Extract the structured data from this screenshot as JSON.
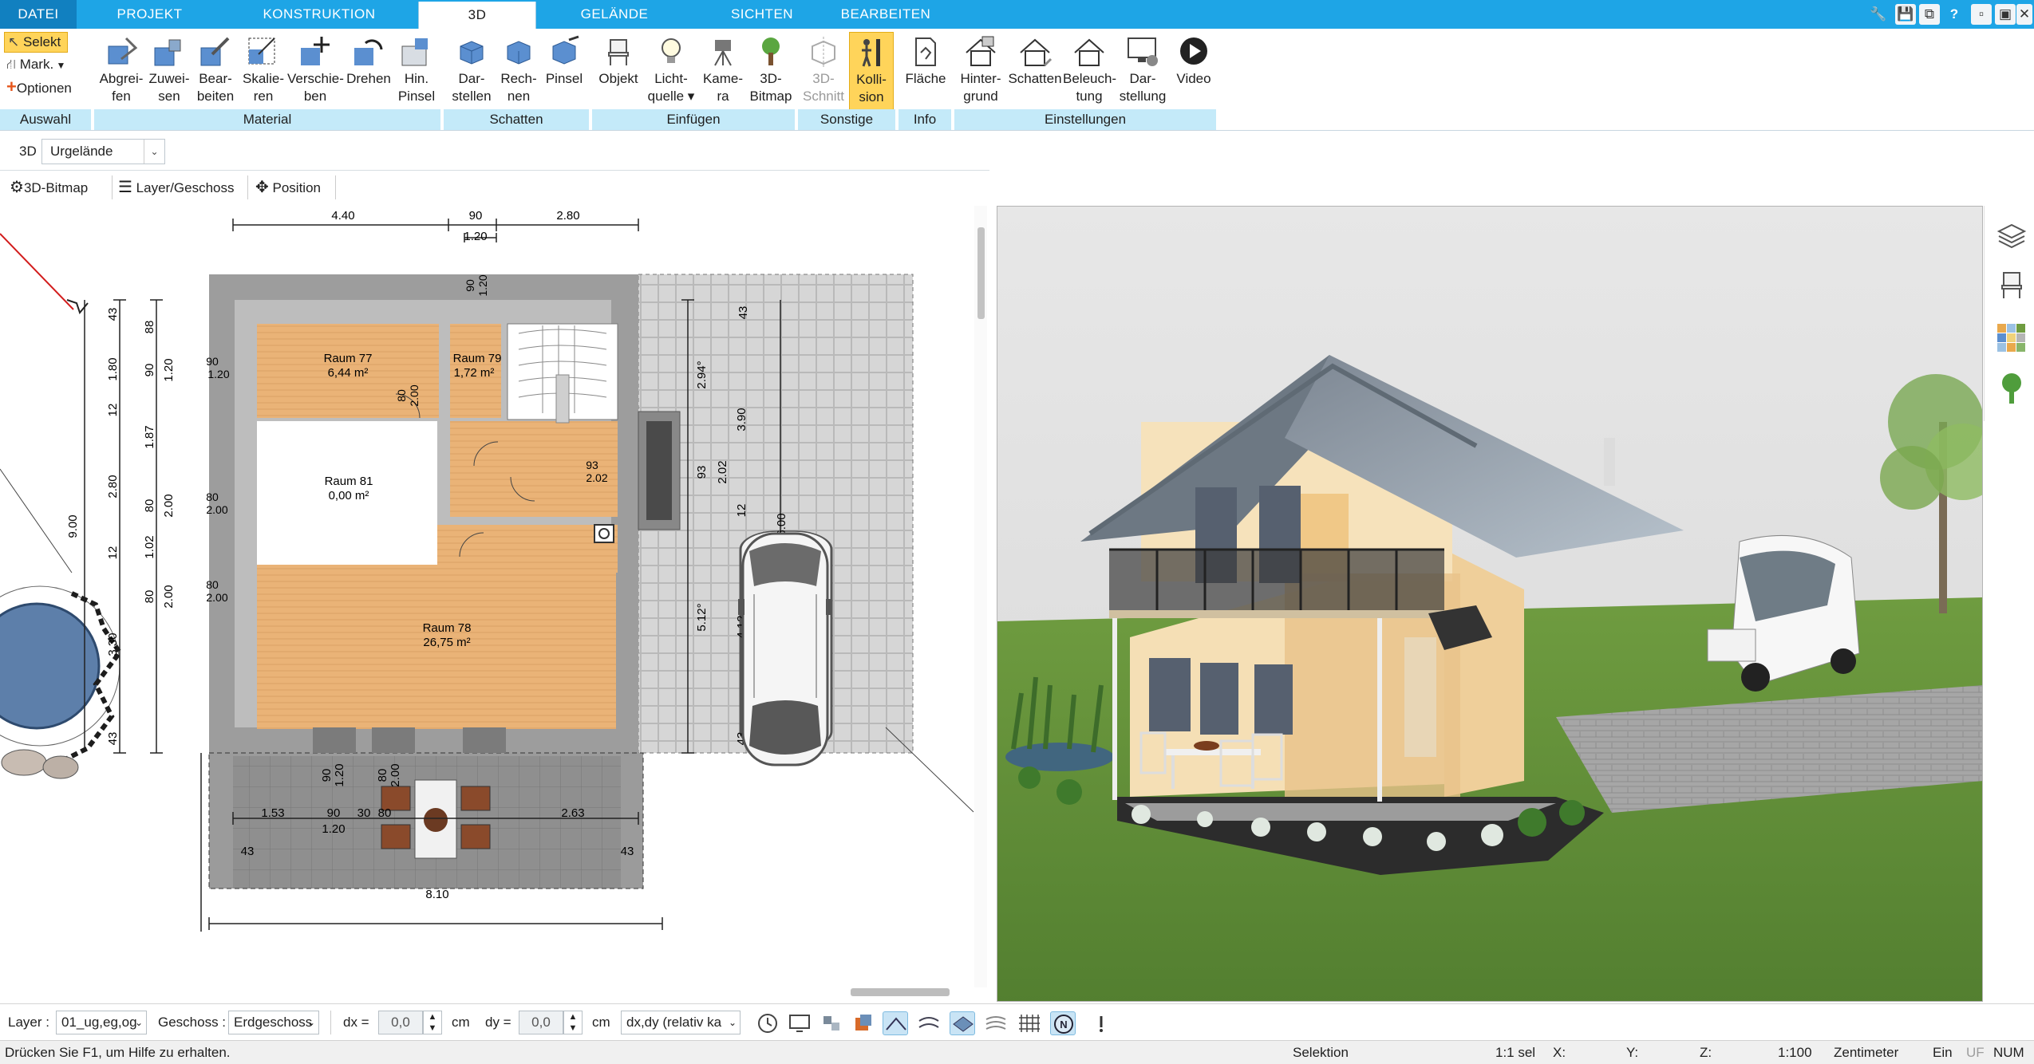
{
  "tabs": [
    {
      "label": "DATEI"
    },
    {
      "label": "PROJEKT"
    },
    {
      "label": "KONSTRUKTION"
    },
    {
      "label": "3D"
    },
    {
      "label": "GELÄNDE"
    },
    {
      "label": "SICHTEN"
    },
    {
      "label": "BEARBEITEN"
    }
  ],
  "window_buttons": {
    "tools": "🔧",
    "save": "💾",
    "copy": "⧉",
    "help": "?",
    "minimize": "▫",
    "restore": "▣",
    "close": "✕"
  },
  "ribbon": {
    "auswahl": {
      "select_label": "Selekt",
      "mark_label": "Mark.",
      "options_label": "Optionen",
      "group": "Auswahl"
    },
    "material": {
      "group": "Material",
      "buttons": [
        {
          "label": "Abgrei-\nfen"
        },
        {
          "label": "Zuwei-\nsen"
        },
        {
          "label": "Bear-\nbeiten"
        },
        {
          "label": "Skalie-\nren"
        },
        {
          "label": "Verschie-\nben"
        },
        {
          "label": "Drehen"
        },
        {
          "label": "Hin.\nPinsel"
        }
      ]
    },
    "schatten": {
      "group": "Schatten",
      "buttons": [
        {
          "label": "Dar-\nstellen"
        },
        {
          "label": "Rech-\nnen"
        },
        {
          "label": "Pinsel"
        }
      ]
    },
    "einfuegen": {
      "group": "Einfügen",
      "buttons": [
        {
          "label": "Objekt"
        },
        {
          "label": "Licht-\nquelle ▾"
        },
        {
          "label": "Kame-\nra"
        },
        {
          "label": "3D-\nBitmap"
        }
      ]
    },
    "sonstige": {
      "group": "Sonstige",
      "buttons": [
        {
          "label": "3D-\nSchnitt"
        },
        {
          "label": "Kolli-\nsion"
        }
      ]
    },
    "info": {
      "group": "Info",
      "buttons": [
        {
          "label": "Fläche"
        }
      ]
    },
    "einstellungen": {
      "group": "Einstellungen",
      "buttons": [
        {
          "label": "Hinter-\ngrund"
        },
        {
          "label": "Schatten"
        },
        {
          "label": "Beleuch-\ntung"
        },
        {
          "label": "Dar-\nstellung"
        },
        {
          "label": "Video"
        }
      ]
    }
  },
  "subbar": {
    "mode": "3D",
    "terrain": "Urgelände",
    "bitmap_btn": "3D-Bitmap",
    "layer_btn": "Layer/Geschoss",
    "position_btn": "Position"
  },
  "plan": {
    "rooms": [
      {
        "name": "Raum 77",
        "area": "6,44 m²"
      },
      {
        "name": "Raum 79",
        "area": "1,72 m²"
      },
      {
        "name": "Raum 81",
        "area": "0,00 m²"
      },
      {
        "name": "Raum 78",
        "area": "26,75 m²"
      }
    ],
    "dims_top": [
      "4.40",
      "90",
      "1.20",
      "2.80"
    ],
    "dims_left_outer": [
      "43",
      "1.80",
      "12",
      "2.80",
      "12",
      "3.30",
      "43",
      "9.00"
    ],
    "dims_left_inner": [
      "88",
      "90",
      "1.20",
      "1.87",
      "80",
      "2.00",
      "1.02",
      "80",
      "2.00"
    ],
    "dims_right": [
      "43",
      "2.94°",
      "3.90",
      "93",
      "2.02",
      "12",
      "5.12°",
      "4.12",
      "6.00",
      "43"
    ],
    "dims_wall": [
      "90",
      "1.20",
      "90",
      "1.20",
      "80",
      "2.00",
      "80",
      "2.00",
      "80",
      "2.00",
      "93",
      "2.02"
    ],
    "dims_bottom": [
      "1.53",
      "90",
      "30",
      "80",
      "2.63",
      "1.20",
      "43",
      "43",
      "8.10",
      "90",
      "1.20",
      "80",
      "2.00"
    ]
  },
  "bottombar": {
    "layer_label": "Layer :",
    "layer_value": "01_ug,eg,og",
    "geschoss_label": "Geschoss :",
    "geschoss_value": "Erdgeschoss",
    "dx_label": "dx =",
    "dx_value": "0,0",
    "dx_unit": "cm",
    "dy_label": "dy =",
    "dy_value": "0,0",
    "dy_unit": "cm",
    "mode_value": "dx,dy (relativ ka"
  },
  "statusbar": {
    "help": "Drücken Sie F1, um Hilfe zu erhalten.",
    "mode": "Selektion",
    "sel": "1:1 sel",
    "x": "X:",
    "y": "Y:",
    "z": "Z:",
    "scale": "1:100",
    "unit": "Zentimeter",
    "ein": "Ein",
    "uf": "UF",
    "num": "NUM"
  },
  "colors": {
    "accent": "#1ea5e6",
    "active_button": "#ffd45a",
    "group_label": "#c4eaf9",
    "floor": "#e8b276",
    "wall": "#aaaaaa",
    "grass": "#5e8f3a",
    "roof": "#8d97a3",
    "house_wall": "#f4ddb0"
  }
}
